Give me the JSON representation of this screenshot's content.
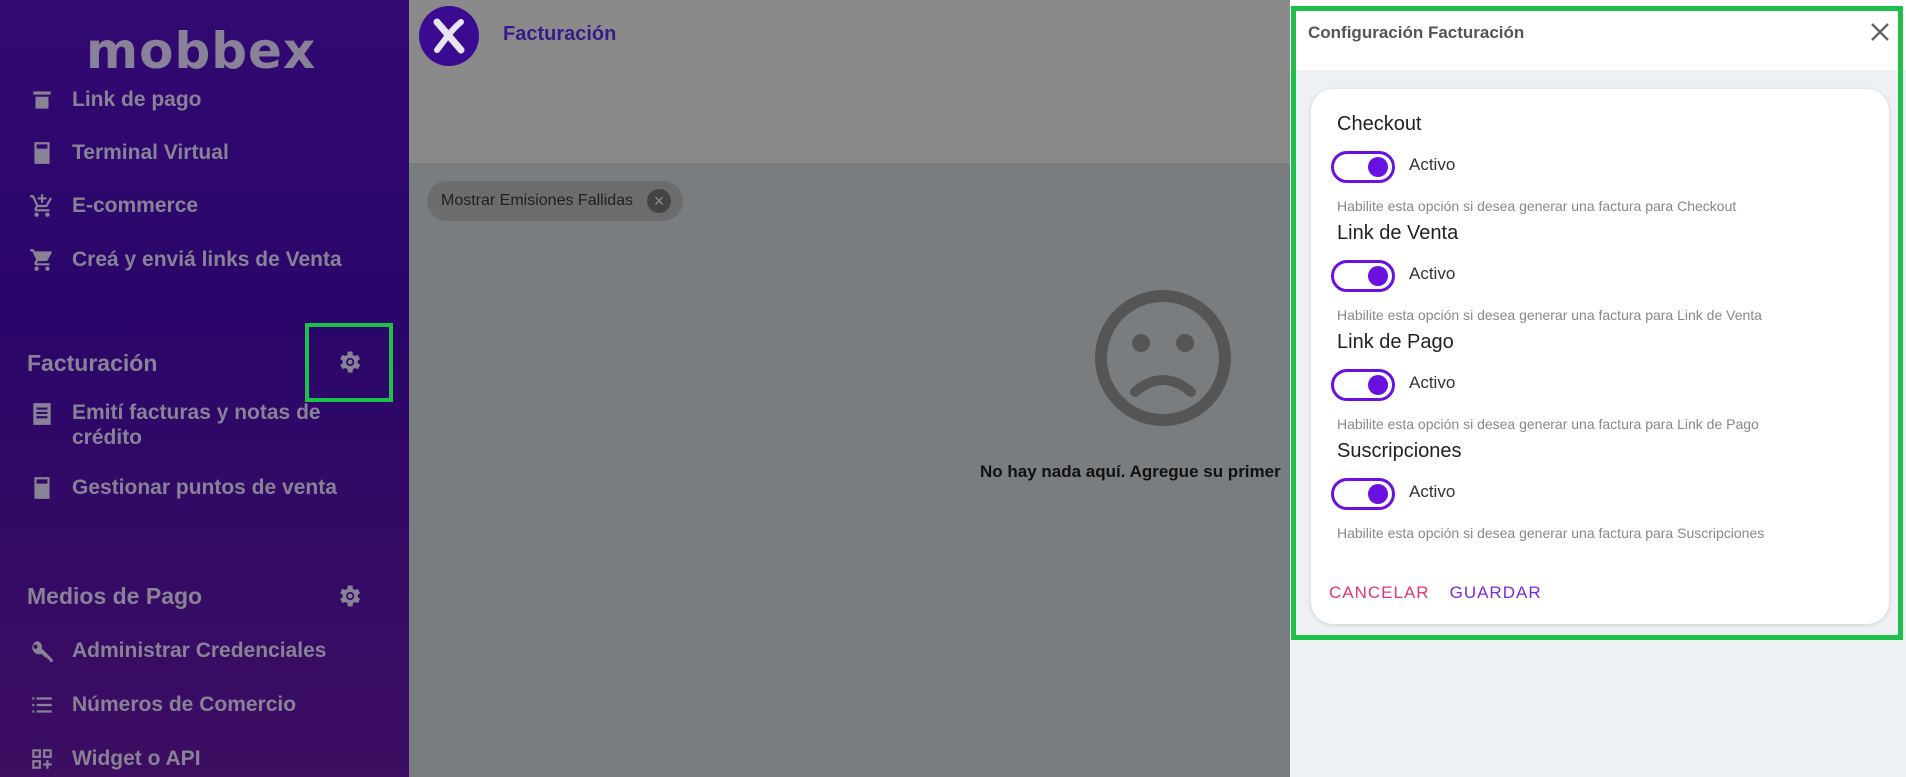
{
  "sidebar": {
    "logo": "mobbex",
    "items_top": [
      {
        "label": "Link de pago",
        "icon": "payment-link-icon"
      },
      {
        "label": "Terminal Virtual",
        "icon": "calculator-icon"
      },
      {
        "label": "E-commerce",
        "icon": "cart-add-icon"
      },
      {
        "label": "Creá y enviá links de Venta",
        "icon": "cart-icon"
      }
    ],
    "section_facturacion": {
      "title": "Facturación",
      "items": [
        {
          "label": "Emití facturas y notas de crédito",
          "icon": "receipt-icon"
        },
        {
          "label": "Gestionar puntos de venta",
          "icon": "calculator-icon"
        }
      ]
    },
    "section_medios": {
      "title": "Medios de Pago",
      "items": [
        {
          "label": "Administrar Credenciales",
          "icon": "key-icon"
        },
        {
          "label": "Números de Comercio",
          "icon": "list-icon"
        },
        {
          "label": "Widget o API",
          "icon": "widgets-icon"
        }
      ]
    }
  },
  "main": {
    "title": "Facturación",
    "chip_label": "Mostrar Emisiones Fallidas",
    "empty_message": "No hay nada aquí. Agregue su primer"
  },
  "panel": {
    "title": "Configuración Facturación",
    "options": [
      {
        "title": "Checkout",
        "toggle_label": "Activo",
        "help": "Habilite esta opción si desea generar una factura para Checkout"
      },
      {
        "title": "Link de Venta",
        "toggle_label": "Activo",
        "help": "Habilite esta opción si desea generar una factura para Link de Venta"
      },
      {
        "title": "Link de Pago",
        "toggle_label": "Activo",
        "help": "Habilite esta opción si desea generar una factura para Link de Pago"
      },
      {
        "title": "Suscripciones",
        "toggle_label": "Activo",
        "help": "Habilite esta opción si desea generar una factura para Suscripciones"
      }
    ],
    "cancel_label": "CANCELAR",
    "save_label": "GUARDAR"
  },
  "colors": {
    "accent": "#6a10e0",
    "cancel": "#e0357a",
    "highlight": "#1fc04a",
    "sidebar": "#4a0fa8"
  }
}
